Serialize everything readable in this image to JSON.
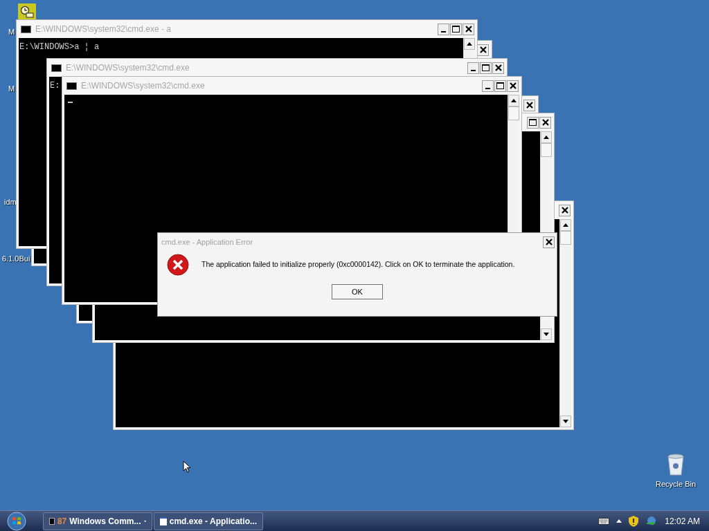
{
  "desktop_icons": [
    {
      "label": "M"
    },
    {
      "label": "M"
    },
    {
      "label": "idm"
    },
    {
      "label": "6.1.0Bui"
    }
  ],
  "windows": [
    {
      "controls": [
        {
          "kind": "close"
        }
      ]
    },
    {
      "controls": [
        {
          "kind": "close"
        }
      ]
    },
    {
      "controls": [
        {
          "kind": "maximize"
        },
        {
          "kind": "close"
        }
      ]
    },
    {
      "controls": [
        {
          "kind": "close"
        }
      ]
    },
    {
      "title": "E:\\WINDOWS\\system32\\cmd.exe - a",
      "console_text": "E:\\WINDOWS>a ¦ a",
      "controls": [
        {
          "kind": "minimize"
        },
        {
          "kind": "maximize"
        },
        {
          "kind": "close"
        }
      ]
    },
    {
      "title": "E:\\WINDOWS\\system32\\cmd.exe",
      "console_text": "E:",
      "controls": [
        {
          "kind": "minimize"
        },
        {
          "kind": "maximize"
        },
        {
          "kind": "close"
        }
      ]
    },
    {
      "title": "E:\\WINDOWS\\system32\\cmd.exe",
      "cursor": true,
      "controls": [
        {
          "kind": "minimize"
        },
        {
          "kind": "maximize"
        },
        {
          "kind": "close"
        }
      ]
    }
  ],
  "dialog": {
    "title": "cmd.exe - Application Error",
    "message": "The application failed to initialize properly (0xc0000142). Click on OK to terminate the application.",
    "button": "OK"
  },
  "recycle_bin": {
    "label": "Recycle Bin"
  },
  "taskbar": {
    "buttons": [
      {
        "kind": "console",
        "count": "87",
        "label": "Windows Comm...",
        "has_menu": true
      },
      {
        "kind": "window",
        "label": "cmd.exe - Applicatio...",
        "has_menu": false
      }
    ],
    "clock": "12:02 AM"
  }
}
